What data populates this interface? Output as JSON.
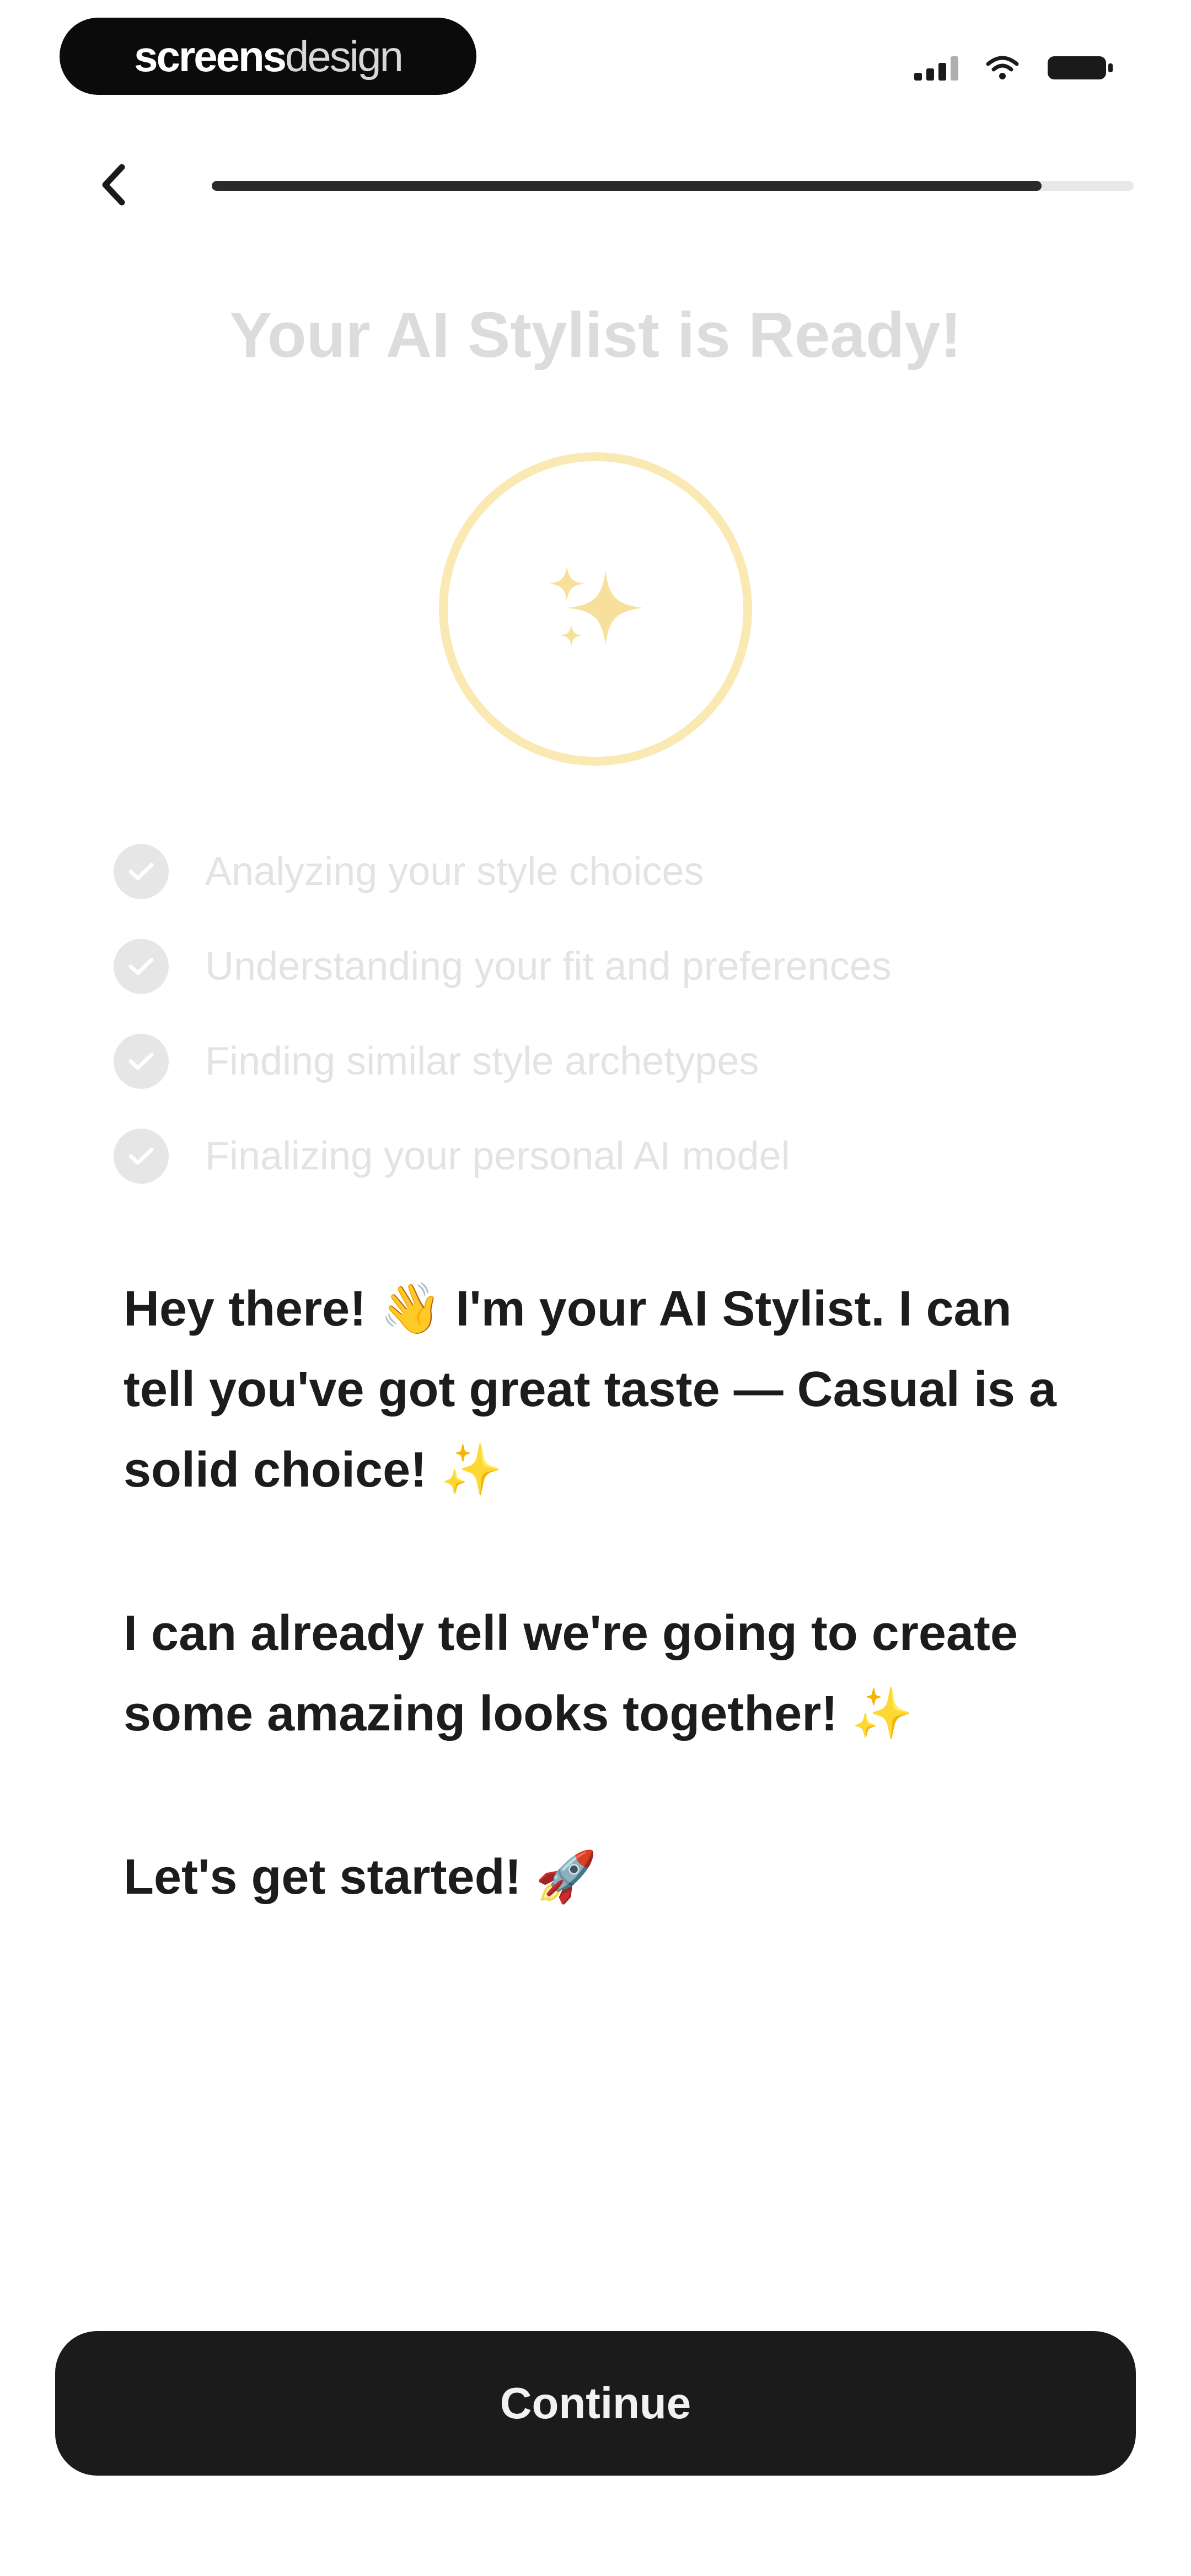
{
  "status_bar": {
    "brand_bold": "screens",
    "brand_light": "design"
  },
  "header": {
    "progress_percent": 90
  },
  "title": "Your AI Stylist is Ready!",
  "checklist": [
    "Analyzing your style choices",
    "Understanding your fit and preferences",
    "Finding similar style archetypes",
    "Finalizing your personal AI model"
  ],
  "message": {
    "paragraph_1": "Hey there! 👋 I'm your AI Stylist. I can tell you've got great taste — Casual is a solid choice! ✨",
    "paragraph_2": "I can already tell we're going to create some amazing looks together! ✨",
    "paragraph_3": "Let's get started! 🚀"
  },
  "continue_label": "Continue",
  "icons": {
    "back": "chevron-left-icon",
    "sparkle": "sparkles-icon",
    "check": "check-circle-icon",
    "signal": "cellular-signal-icon",
    "wifi": "wifi-icon",
    "battery": "battery-icon"
  },
  "colors": {
    "accent_ring": "#fbe9b3",
    "sparkle": "#f7df9c",
    "button": "#1b1b1b",
    "progress": "#2a2a2a"
  }
}
